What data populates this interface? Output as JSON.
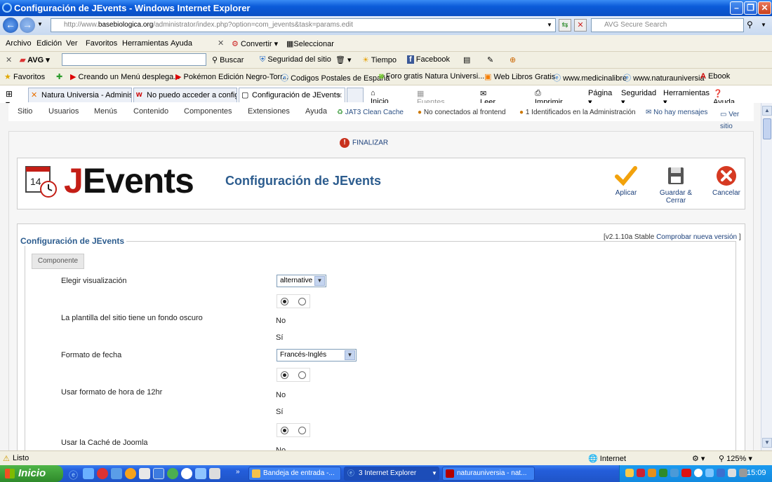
{
  "window": {
    "title": "Configuración de JEvents - Windows Internet Explorer"
  },
  "address": {
    "url_prefix": "http://www.",
    "url_domain": "basebiologica.org",
    "url_rest": "/administrator/index.php?option=com_jevents&task=params.edit",
    "search_placeholder": "AVG Secure Search"
  },
  "menubar": {
    "items": [
      "Archivo",
      "Edición",
      "Ver",
      "Favoritos",
      "Herramientas",
      "Ayuda"
    ],
    "convert": "Convertir",
    "select": "Seleccionar"
  },
  "avgbar": {
    "brand": "AVG",
    "search": "Buscar",
    "security": "Seguridad del sitio",
    "weather": "Tiempo",
    "facebook": "Facebook"
  },
  "favbar": {
    "label": "Favoritos",
    "items": [
      "Creando un Menú desplega...",
      "Pokémon Edición Negro-Torr...",
      "Codigos Postales de España",
      "Foro gratis  Natura Universi...",
      "Web Libros Gratis",
      "www.medicinalibre",
      "www.naturauniversia",
      "Ebook"
    ]
  },
  "tabs": {
    "items": [
      "Natura Universia - Administr...",
      "No puedo acceder a configu...",
      "Configuración de JEvents"
    ]
  },
  "commandbar": {
    "home": "Inicio",
    "feeds": "Fuentes (J)",
    "mail": "Leer correo",
    "print": "Imprimir",
    "page": "Página",
    "safety": "Seguridad",
    "tools": "Herramientas",
    "help": "Ayuda"
  },
  "joomla": {
    "menu": [
      "Sitio",
      "Usuarios",
      "Menús",
      "Contenido",
      "Componentes",
      "Extensiones",
      "Ayuda"
    ],
    "status": {
      "cache": "JAT3 Clean Cache",
      "frontend": "No conectados al frontend",
      "admin": "1 Identificados en la Administración",
      "messages": "No hay mensajes",
      "view_site": "Ver sitio"
    },
    "finalizar": "FINALIZAR",
    "page_title": "Configuración de JEvents",
    "toolbar": {
      "apply": "Aplicar",
      "save_close": "Guardar & Cerrar",
      "cancel": "Cancelar"
    }
  },
  "logo": {
    "j": "J",
    "rest": "Events",
    "calendar_day": "14"
  },
  "config": {
    "legend": "Configuración de JEvents",
    "version_text": "[v2.1.10a Stable",
    "version_link": "Comprobar nueva versión",
    "version_close": "]",
    "tab": "Componente",
    "view_label": "Elegir visualización",
    "view_value": "alternative",
    "dark_label": "La plantilla del sitio tiene un fondo oscuro",
    "date_label": "Formato de fecha",
    "date_value": "Francés-Inglés",
    "hour_label": "Usar formato de hora de 12hr",
    "cache_label": "Usar la Caché de Joomla",
    "opt_no": "No",
    "opt_si": "Sí",
    "opt_partial": "No"
  },
  "statusbar": {
    "status": "Listo",
    "zone": "Internet",
    "zoom": "125%"
  },
  "taskbar": {
    "start": "Inicio",
    "tasks": [
      "Bandeja de entrada -...",
      "3 Internet Explorer",
      "naturauniversia - nat..."
    ],
    "clock": "15:09"
  }
}
